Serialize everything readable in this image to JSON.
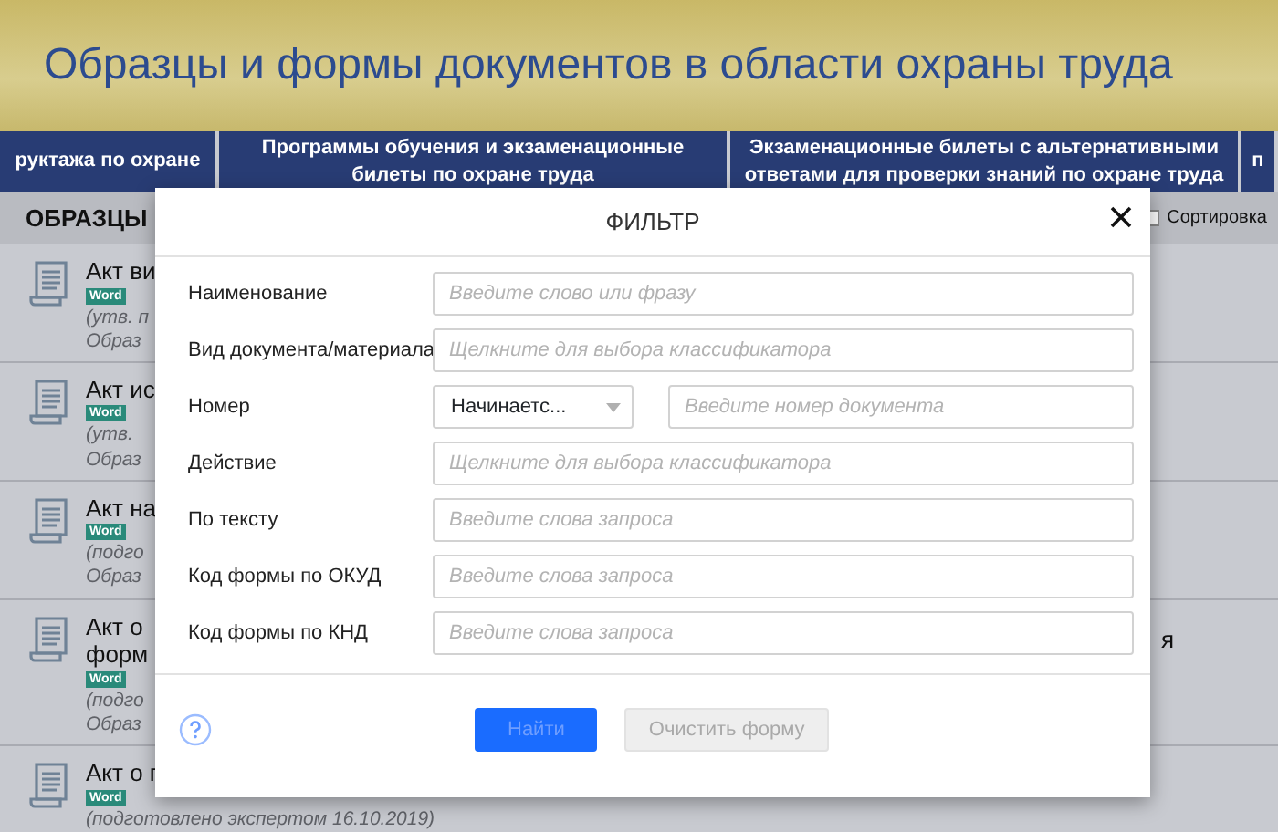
{
  "page_title": "Образцы и формы документов в области охраны труда",
  "nav_tabs": [
    {
      "label": "руктажа по охране"
    },
    {
      "label": "Программы обучения и экзаменационные билеты по охране труда"
    },
    {
      "label": "Экзаменационные билеты с альтернативными ответами для проверки знаний по охране труда"
    },
    {
      "label": "п"
    }
  ],
  "section": {
    "title": "ОБРАЗЦЫ",
    "sort_label": "Сортировка",
    "sort_checked": false
  },
  "documents": [
    {
      "title_lines": [
        "Акт ви"
      ],
      "badge": "Word",
      "note": "(утв. п",
      "source": "Образ"
    },
    {
      "title_lines": [
        "Акт ис"
      ],
      "badge": "Word",
      "note": "(утв.",
      "source": "Образ"
    },
    {
      "title_lines": [
        "Акт на"
      ],
      "badge": "Word",
      "note": "(подго",
      "source": "Образ"
    },
    {
      "title_lines": [
        "Акт о",
        "форм"
      ],
      "badge": "Word",
      "note": "(подго",
      "source": "Образ",
      "trailing": "я"
    },
    {
      "title_lines": [
        "Акт о г"
      ],
      "badge": "Word",
      "note": "(подготовлено экспертом 16.10.2019)"
    }
  ],
  "filter_dialog": {
    "title": "ФИЛЬТР",
    "fields": [
      {
        "kind": "text",
        "label": "Наименование",
        "placeholder": "Введите слово или фразу"
      },
      {
        "kind": "text",
        "label": "Вид документа/материала",
        "placeholder": "Щелкните для выбора классификатора"
      },
      {
        "kind": "number",
        "label": "Номер",
        "select_value": "Начинаетс...",
        "placeholder": "Введите номер документа"
      },
      {
        "kind": "text",
        "label": "Действие",
        "placeholder": "Щелкните для выбора классификатора"
      },
      {
        "kind": "text",
        "label": "По тексту",
        "placeholder": "Введите слова запроса"
      },
      {
        "kind": "text",
        "label": "Код формы по ОКУД",
        "placeholder": "Введите слова запроса"
      },
      {
        "kind": "text",
        "label": "Код формы по КНД",
        "placeholder": "Введите слова запроса"
      }
    ],
    "buttons": [
      {
        "label": "Найти",
        "kind": "primary",
        "disabled": true
      },
      {
        "label": "Очистить форму",
        "kind": "secondary",
        "disabled": true
      }
    ]
  }
}
